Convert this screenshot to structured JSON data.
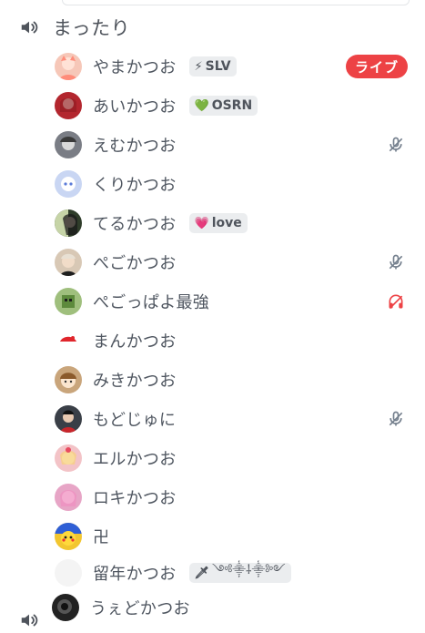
{
  "channel": {
    "name": "まったり",
    "icon": "speaker-icon"
  },
  "users": [
    {
      "name": "やまかつお",
      "avatar_color": "#f6c7b8",
      "tag": {
        "emoji": "⚡",
        "text": "SLV"
      },
      "live": "ライブ"
    },
    {
      "name": "あいかつお",
      "avatar_color": "#b3262e",
      "tag": {
        "emoji": "💚",
        "text": "OSRN"
      }
    },
    {
      "name": "えむかつお",
      "avatar_color": "#7a7d85",
      "status_icon": "mic-muted-icon"
    },
    {
      "name": "くりかつお",
      "avatar_color": "#c9d6f3"
    },
    {
      "name": "てるかつお",
      "avatar_color": "#2f3d2a",
      "tag": {
        "emoji": "💗",
        "text": "love"
      }
    },
    {
      "name": "ぺごかつお",
      "avatar_color": "#d8c8b5",
      "status_icon": "mic-muted-icon"
    },
    {
      "name": "ぺごっぱよ最強",
      "avatar_color": "#9fbf7d",
      "status_icon": "headset-deafened-icon"
    },
    {
      "name": "まんかつお",
      "avatar_color": "#ffffff"
    },
    {
      "name": "みきかつお",
      "avatar_color": "#c9a57b"
    },
    {
      "name": "もどじゅに",
      "avatar_color": "#3a3f47",
      "status_icon": "mic-muted-icon"
    },
    {
      "name": "エルかつお",
      "avatar_color": "#f3c3c7"
    },
    {
      "name": "ロキかつお",
      "avatar_color": "#e7a5c6"
    },
    {
      "name": "卍",
      "avatar_color": "#f2c630"
    },
    {
      "name": "留年かつお",
      "avatar_color": "#f4f4f4",
      "tag": {
        "emoji": "🗡",
        "text": "༺⸎⸸⸎༻"
      }
    },
    {
      "name": "うぇどかつお",
      "avatar_color": "#222222"
    }
  ],
  "colors": {
    "text": "#4f5660",
    "live": "#ed4245",
    "muted_icon": "#747f8d",
    "deafened_icon": "#ed4245",
    "tag_bg": "#ebedef"
  }
}
